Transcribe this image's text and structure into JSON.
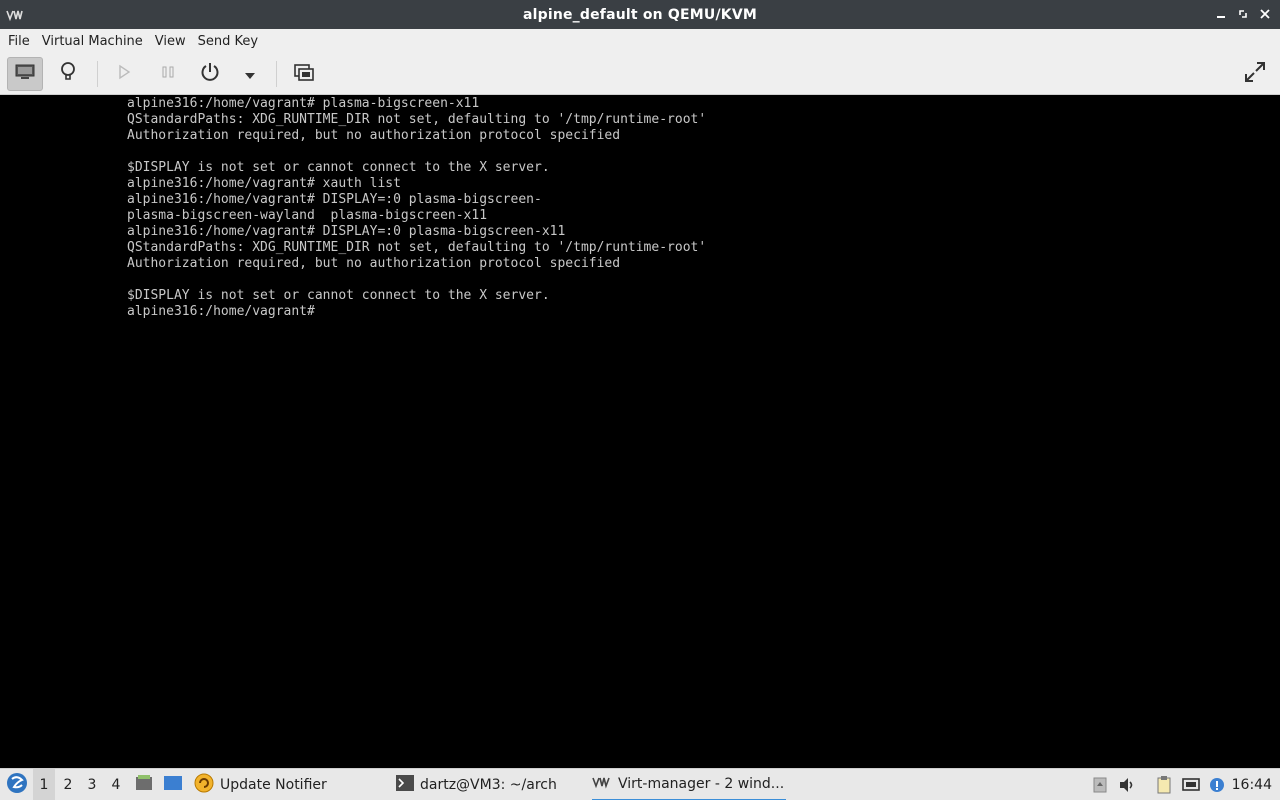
{
  "window": {
    "title": "alpine_default on QEMU/KVM",
    "controls": [
      "minimize-icon",
      "restore-icon",
      "close-icon"
    ]
  },
  "menu": {
    "file": "File",
    "virtual_machine": "Virtual Machine",
    "view": "View",
    "send_key": "Send Key"
  },
  "toolbar": {
    "buttons": [
      "console-icon",
      "lightbulb-icon",
      "play-icon",
      "pause-icon",
      "power-icon",
      "chevron-down-icon",
      "snapshots-icon",
      "fullscreen-icon"
    ]
  },
  "console": {
    "lines": [
      "alpine316:/home/vagrant# plasma-bigscreen-x11",
      "QStandardPaths: XDG_RUNTIME_DIR not set, defaulting to '/tmp/runtime-root'",
      "Authorization required, but no authorization protocol specified",
      "",
      "$DISPLAY is not set or cannot connect to the X server.",
      "alpine316:/home/vagrant# xauth list",
      "alpine316:/home/vagrant# DISPLAY=:0 plasma-bigscreen-",
      "plasma-bigscreen-wayland  plasma-bigscreen-x11",
      "alpine316:/home/vagrant# DISPLAY=:0 plasma-bigscreen-x11",
      "QStandardPaths: XDG_RUNTIME_DIR not set, defaulting to '/tmp/runtime-root'",
      "Authorization required, but no authorization protocol specified",
      "",
      "$DISPLAY is not set or cannot connect to the X server.",
      "alpine316:/home/vagrant#"
    ]
  },
  "taskbar": {
    "workspaces": [
      "1",
      "2",
      "3",
      "4"
    ],
    "active_workspace": "1",
    "tasks": {
      "update_notifier": "Update Notifier",
      "terminal": "dartz@VM3: ~/arch",
      "virt_manager": "Virt-manager - 2 wind..."
    },
    "clock": "16:44"
  },
  "colors": {
    "titlebar": "#3a3f44",
    "console_bg": "#000000",
    "console_text": "#c8c8c8",
    "accent": "#3b8ed8"
  }
}
